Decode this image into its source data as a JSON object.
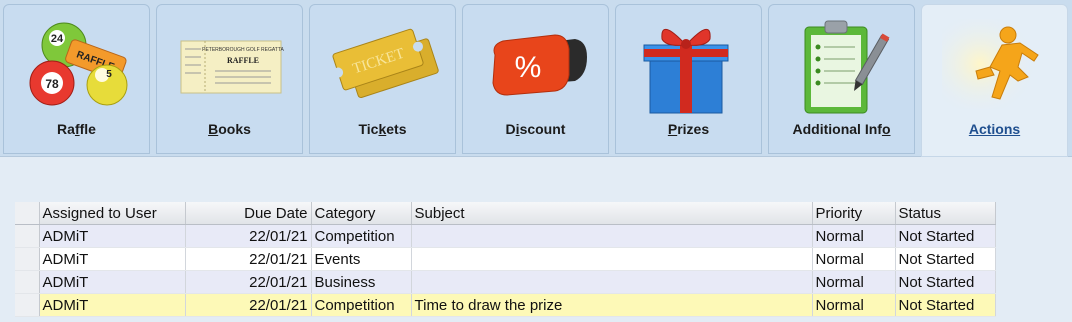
{
  "tabs": [
    {
      "label_pre": "Ra",
      "label_u": "f",
      "label_post": "fle",
      "icon": "raffle-balls-icon"
    },
    {
      "label_pre": "",
      "label_u": "B",
      "label_post": "ooks",
      "icon": "raffle-book-icon"
    },
    {
      "label_pre": "Tic",
      "label_u": "k",
      "label_post": "ets",
      "icon": "ticket-icon"
    },
    {
      "label_pre": "D",
      "label_u": "i",
      "label_post": "scount",
      "icon": "discount-tag-icon"
    },
    {
      "label_pre": "",
      "label_u": "P",
      "label_post": "rizes",
      "icon": "gift-box-icon"
    },
    {
      "label_pre": "Additional Inf",
      "label_u": "o",
      "label_post": "",
      "icon": "clipboard-icon"
    },
    {
      "label_pre": "",
      "label_u": "",
      "label_post": "Actions",
      "icon": "running-man-icon",
      "active": true
    }
  ],
  "ticket_texts": {
    "book_header": "PETERBOROUGH GOLF REGATTA",
    "book_title": "RAFFLE",
    "ticket_word": "TICKET",
    "raffle_ball_24": "24",
    "raffle_ball_78": "78",
    "raffle_ball_5": "5",
    "raffle_tag": "RAFFLE",
    "percent": "%"
  },
  "grid": {
    "headers": [
      "Assigned to User",
      "Due Date",
      "Category",
      "Subject",
      "Priority",
      "Status"
    ],
    "rows": [
      {
        "user": "ADMiT",
        "due": "22/01/21",
        "category": "Competition",
        "subject": "",
        "priority": "Normal",
        "status": "Not Started"
      },
      {
        "user": "ADMiT",
        "due": "22/01/21",
        "category": "Events",
        "subject": "",
        "priority": "Normal",
        "status": "Not Started"
      },
      {
        "user": "ADMiT",
        "due": "22/01/21",
        "category": "Business",
        "subject": "",
        "priority": "Normal",
        "status": "Not Started"
      },
      {
        "user": "ADMiT",
        "due": "22/01/21",
        "category": "Competition",
        "subject": "Time to draw the prize",
        "priority": "Normal",
        "status": "Not Started"
      }
    ]
  }
}
